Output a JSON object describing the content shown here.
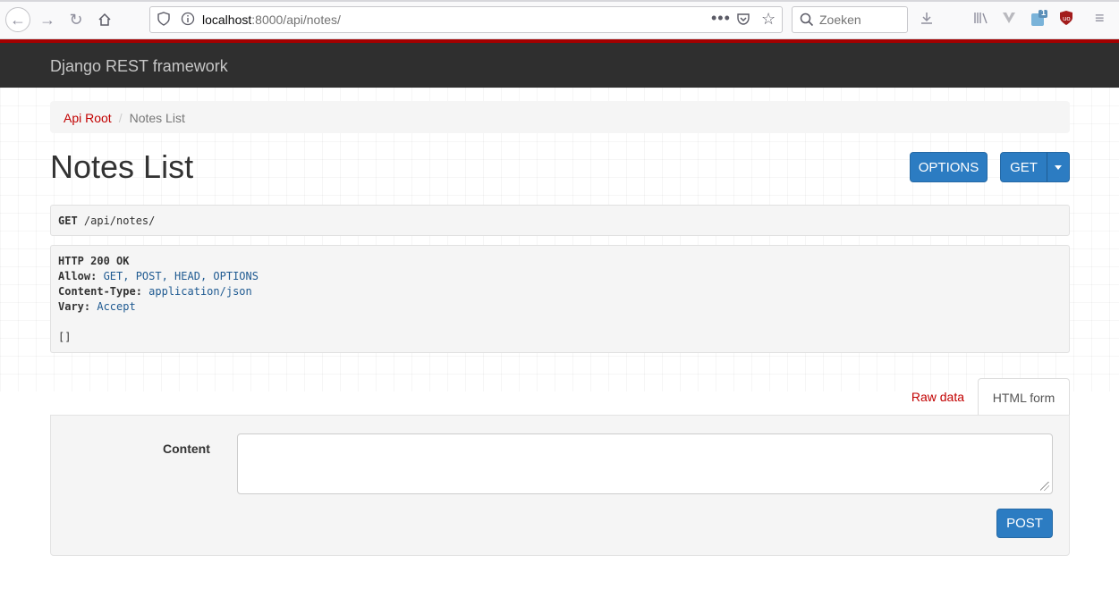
{
  "browser": {
    "url_host": "localhost",
    "url_rest": ":8000/api/notes/",
    "search_placeholder": "Zoeken",
    "extension_badge": "1"
  },
  "navbar": {
    "brand": "Django REST framework"
  },
  "breadcrumb": {
    "root": "Api Root",
    "separator": "/",
    "current": "Notes List"
  },
  "page": {
    "title": "Notes List"
  },
  "actions": {
    "options_label": "OPTIONS",
    "get_label": "GET"
  },
  "request": {
    "method": "GET",
    "path": " /api/notes/"
  },
  "response": {
    "status": "HTTP 200 OK",
    "headers": [
      {
        "name": "Allow:",
        "value": " GET, POST, HEAD, OPTIONS"
      },
      {
        "name": "Content-Type:",
        "value": " application/json"
      },
      {
        "name": "Vary:",
        "value": " Accept"
      }
    ],
    "body": "[]"
  },
  "tabs": {
    "raw": "Raw data",
    "html": "HTML form"
  },
  "form": {
    "content_label": "Content",
    "content_value": "",
    "submit_label": "POST"
  },
  "colors": {
    "navbar": "#2f2f2f",
    "accent_red": "#a30000",
    "link_red": "#c20000",
    "button_blue": "#2c7cc2"
  }
}
